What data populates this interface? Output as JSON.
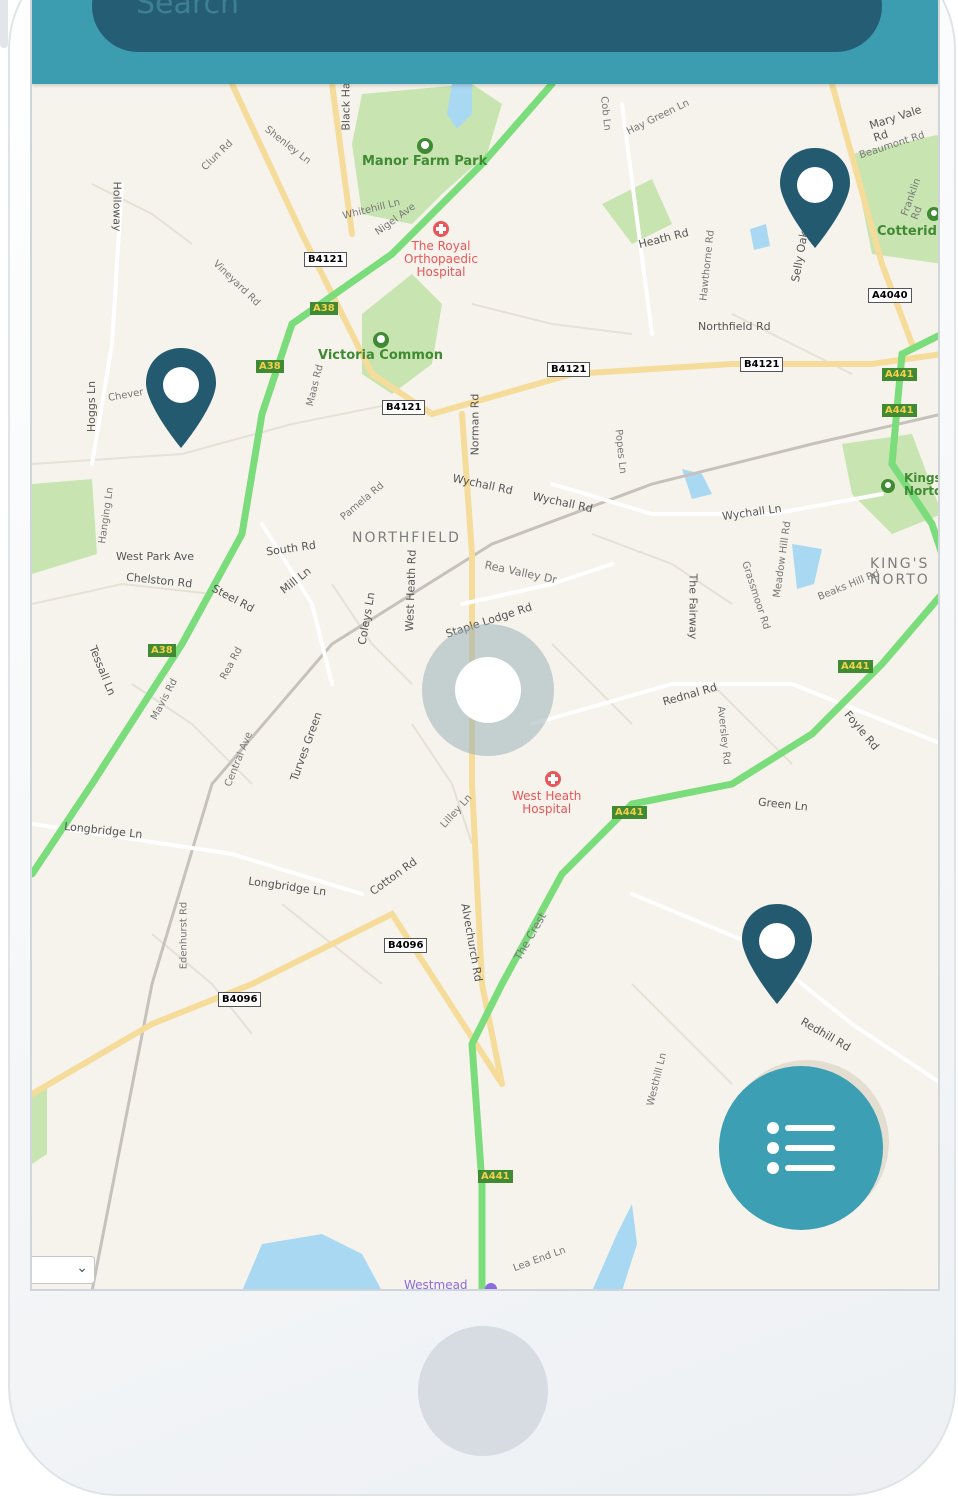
{
  "search": {
    "placeholder": "Search",
    "icon": "search-icon"
  },
  "map": {
    "area_label": "Northfield",
    "places": [
      {
        "name": "Manor Farm Park",
        "type": "park"
      },
      {
        "name": "Victoria Common",
        "type": "park"
      },
      {
        "name": "The Royal",
        "line2": "Orthopaedic",
        "line3": "Hospital",
        "type": "hospital"
      },
      {
        "name": "West Heath",
        "line2": "Hospital",
        "type": "hospital"
      },
      {
        "name": "Cotterid",
        "type": "park"
      },
      {
        "name": "Kings",
        "line2": "Nortc",
        "type": "park"
      },
      {
        "name": "Westmead",
        "type": "place"
      },
      {
        "name": "King's",
        "line2": "Norto",
        "type": "district"
      }
    ],
    "road_badges": [
      "B4121",
      "B4121",
      "B4121",
      "B4121",
      "A38",
      "A38",
      "A38",
      "A4040",
      "A441",
      "A441",
      "A441",
      "A441",
      "A441",
      "B4096",
      "B4096"
    ],
    "streets": [
      "Heath Rd",
      "Northfield Rd",
      "Wychall Rd",
      "Wychall Rd",
      "Wychall Ln",
      "South Rd",
      "Mill Ln",
      "West Park Ave",
      "Chelston Rd",
      "Steel Rd",
      "Staple Lodge Rd",
      "Rea Valley Dr",
      "The Fairway",
      "Rednal Rd",
      "Green Ln",
      "Foyle Rd",
      "Longbridge Ln",
      "Longbridge Ln",
      "Cotton Rd",
      "Alvechurch Rd",
      "The Crest",
      "Redhill Rd",
      "Turves Green",
      "Central Ave",
      "Mavis Rd",
      "Tessall Ln",
      "Rea Rd",
      "Coleys Ln",
      "West Heath Rd",
      "Norman Rd",
      "Pamela Rd",
      "Maas Rd",
      "Vineyard Rd",
      "Clun Rd",
      "Shenley Ln",
      "Holloway",
      "Hoggs Ln",
      "Hanging Ln",
      "Nigel Ave",
      "Whitehill Ln",
      "Black Ha",
      "Hay Green Ln",
      "Cob Ln",
      "Mary Vale Rd",
      "Beaumont Rd",
      "Franklin Rd",
      "Hawthorne Rd",
      "Selly Oak",
      "Meadow Hill Rd",
      "Beaks Hill Rd",
      "Grassmoor Rd",
      "Aversley Rd",
      "Lilley Ln",
      "Edenhurst Rd",
      "Westhill Ln",
      "Lea End Ln",
      "Popes Ln",
      "Chever"
    ]
  },
  "markers": [
    "map-pin-icon",
    "map-pin-icon",
    "map-pin-icon"
  ],
  "list_button": {
    "icon": "list-icon"
  },
  "colors": {
    "header": "#3c9cb0",
    "search_bar": "#255e74",
    "pin": "#245a70",
    "fab": "#3c9fb3",
    "map_bg": "#f6f3ec",
    "park": "#c8e5b1",
    "water": "#a9d8f2",
    "main_road": "#7bdc7b",
    "secondary_road": "#f6dc9a"
  }
}
